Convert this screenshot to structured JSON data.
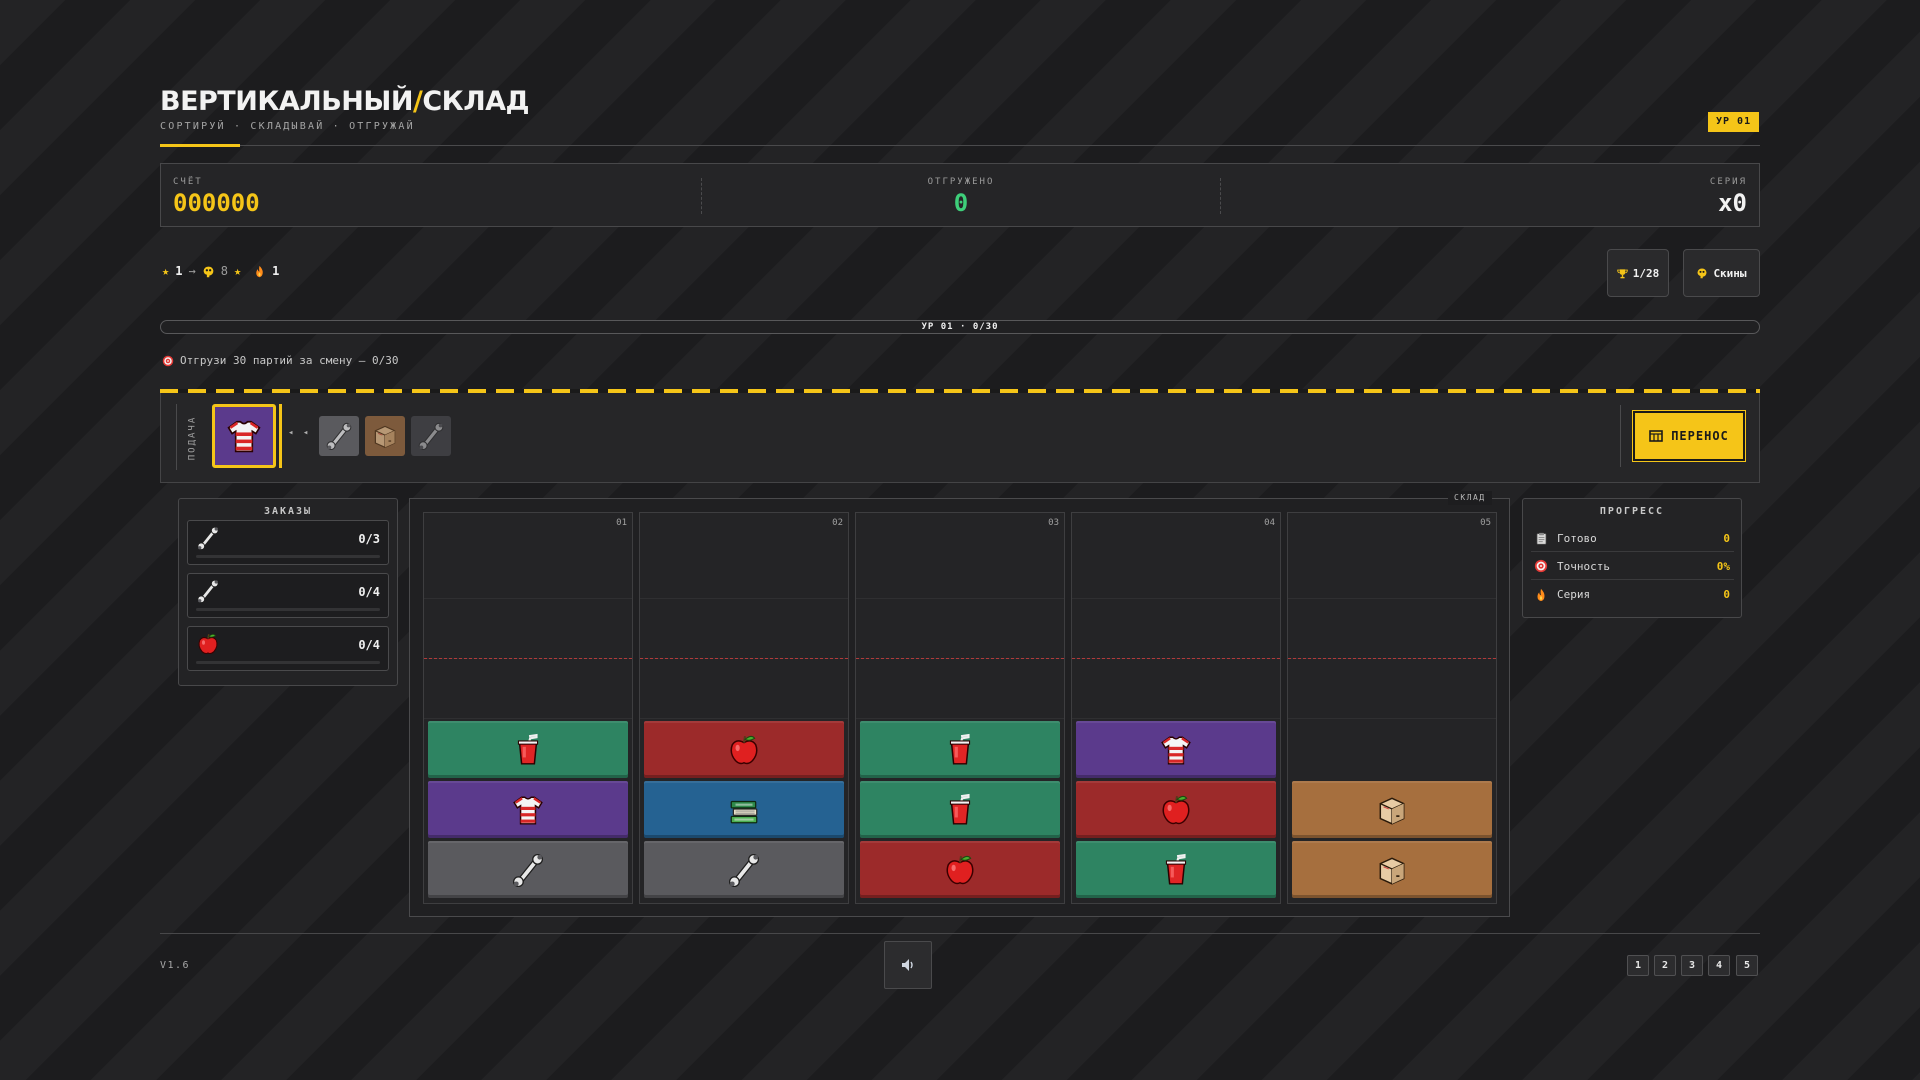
{
  "header": {
    "title_left": "ВЕРТИКАЛЬНЫЙ",
    "title_sep": "/",
    "title_right": "СКЛАД",
    "subtitle": "СОРТИРУЙ · СКЛАДЫВАЙ · ОТГРУЖАЙ",
    "level_badge": "УР 01"
  },
  "score": {
    "score_label": "СЧЁТ",
    "score_value": "000000",
    "shipped_label": "ОТГРУЖЕНО",
    "shipped_value": "0",
    "streak_label": "СЕРИЯ",
    "streak_value": "x0"
  },
  "stats": {
    "stars": "1",
    "arrow": "→",
    "coins": "8",
    "flame": "1",
    "trophies": "1/28",
    "skins_label": "Скины"
  },
  "progress": {
    "label": "УР 01 · 0/30",
    "fraction": 0,
    "goal_text": "Отгрузи 30 партий за смену — 0/30"
  },
  "conveyor": {
    "feed_label": "ПОДАЧА",
    "arrows": "◂ ◂",
    "current_item": "shirt",
    "queue": [
      "wrench",
      "box",
      "wrench"
    ],
    "transfer_label": "ПЕРЕНОС"
  },
  "orders": {
    "title": "ЗАКАЗЫ",
    "items": [
      {
        "icon": "wrench",
        "count": "0/3"
      },
      {
        "icon": "wrench",
        "count": "0/4"
      },
      {
        "icon": "apple",
        "count": "0/4"
      }
    ]
  },
  "warehouse": {
    "tag": "СКЛАД",
    "columns": [
      {
        "num": "01",
        "stack_bottom_to_top": [
          "wrench",
          "shirt",
          "drink"
        ]
      },
      {
        "num": "02",
        "stack_bottom_to_top": [
          "wrench",
          "books",
          "apple"
        ]
      },
      {
        "num": "03",
        "stack_bottom_to_top": [
          "apple",
          "drink",
          "drink"
        ]
      },
      {
        "num": "04",
        "stack_bottom_to_top": [
          "drink",
          "apple",
          "shirt"
        ]
      },
      {
        "num": "05",
        "stack_bottom_to_top": [
          "box",
          "box"
        ]
      }
    ]
  },
  "progress_panel": {
    "title": "ПРОГРЕСС",
    "rows": [
      {
        "label": "Готово",
        "value": "0"
      },
      {
        "label": "Точность",
        "value": "0%"
      },
      {
        "label": "Серия",
        "value": "0"
      }
    ]
  },
  "footer": {
    "version": "V1.6",
    "level_buttons": [
      "1",
      "2",
      "3",
      "4",
      "5"
    ]
  },
  "colors": {
    "accent": "#f5c518",
    "shipped": "#3ecf7a",
    "drink": "#2e8462",
    "shirt": "#5b3a8c",
    "wrench": "#5a5a5e",
    "apple": "#9c2a2a",
    "books": "#256292",
    "box": "#a66f3e"
  }
}
